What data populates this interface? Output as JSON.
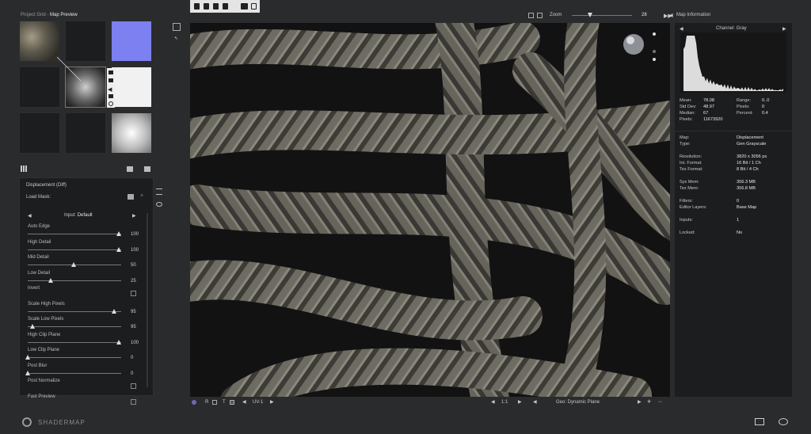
{
  "header": {
    "breadcrumb_project": "Project Grid",
    "breadcrumb_sep": " - ",
    "breadcrumb_view": "Map Preview",
    "zoom_label": "Zoom",
    "zoom_value": "28",
    "zoom_level": 0.3
  },
  "toolbar_icons": [
    "new-file-icon",
    "open-folder-icon",
    "save-icon",
    "save-all-icon",
    "tools-icon",
    "script-icon"
  ],
  "thumb_tools": [
    "lock-icon",
    "pen-icon",
    "arrow-left-icon",
    "save-icon",
    "info-icon"
  ],
  "params": {
    "map_name": "Displacement (Diff)",
    "load_mask_label": "Load Mask:",
    "input_prefix": "Input: ",
    "input_value": "Default",
    "sliders": [
      {
        "label": "Auto Edge",
        "value": "100",
        "level": 1.0
      },
      {
        "label": "High Detail",
        "value": "100",
        "level": 1.0
      },
      {
        "label": "Mid Detail",
        "value": "50",
        "level": 0.5
      },
      {
        "label": "Low Detail",
        "value": "25",
        "level": 0.25
      },
      {
        "label": "Invert",
        "checkbox": true
      },
      {
        "label": "Scale High Pixels",
        "value": "95",
        "level": 0.95
      },
      {
        "label": "Scale Low Pixels",
        "value": "95",
        "level": 0.05
      },
      {
        "label": "High Clip Plane",
        "value": "100",
        "level": 1.0
      },
      {
        "label": "Low Clip Plane",
        "value": "0",
        "level": 0.0
      },
      {
        "label": "Post Blur",
        "value": "0",
        "level": 0.0
      },
      {
        "label": "Post Normalize",
        "checkbox": true
      },
      {
        "label": "Fast Preview",
        "checkbox": true
      }
    ]
  },
  "info": {
    "title": "Map Information",
    "channel_label": "Channel: Gray",
    "stats_left": [
      {
        "k": "Mean:",
        "v": "78.08"
      },
      {
        "k": "Std Dev:",
        "v": "48.97"
      },
      {
        "k": "Median:",
        "v": "67"
      },
      {
        "k": "Pixels:",
        "v": "11673920"
      }
    ],
    "stats_right": [
      {
        "k": "Range:",
        "v": "0..0"
      },
      {
        "k": "Pixels:",
        "v": "0"
      },
      {
        "k": "Percent:",
        "v": "0.4"
      }
    ],
    "details": [
      {
        "k": "Map:",
        "v": "Displacement"
      },
      {
        "k": "Type:",
        "v": "Gen Grayscale"
      },
      {
        "k": "Resolution:",
        "v": "3820 x 3056 px"
      },
      {
        "k": "Int. Format:",
        "v": "16 Bit / 1 Ch"
      },
      {
        "k": "Tex Format:",
        "v": "8 Bit / 4 Ch"
      },
      {
        "k": "Sys Mem:",
        "v": "356.3 MB"
      },
      {
        "k": "Tex Mem:",
        "v": "356.8 MB"
      },
      {
        "k": "Filters:",
        "v": "0"
      },
      {
        "k": "Editor Layers:",
        "v": "Base Map"
      },
      {
        "k": "Inputs:",
        "v": "1"
      },
      {
        "k": "Locked:",
        "v": "No"
      }
    ]
  },
  "bottom": {
    "uv_label": "UV-1",
    "channel_letters": [
      "R",
      "T"
    ],
    "ratio": "1:1",
    "geo_label": "Geo: Dynamic Plane"
  },
  "footer": {
    "brand": "SHADERMAP"
  },
  "colors": {
    "bg": "#2a2b2d",
    "panel": "#1c1d1f",
    "normal_map": "#7d80f0",
    "accent": "#e8e8e8"
  }
}
